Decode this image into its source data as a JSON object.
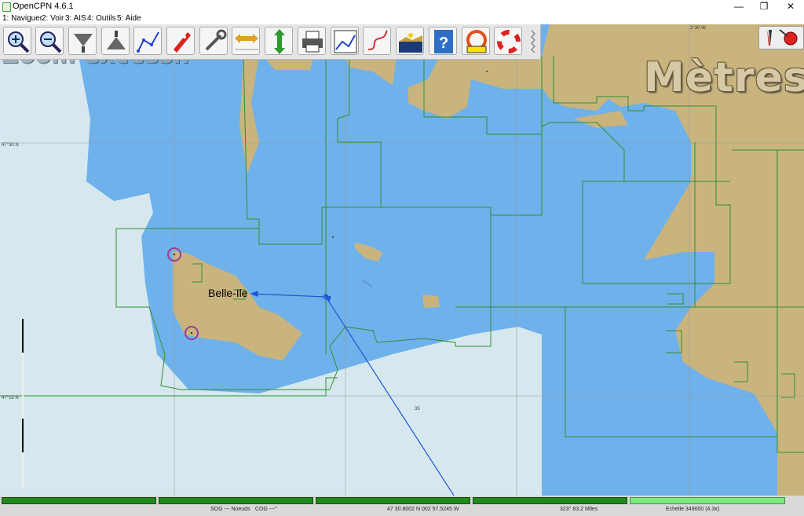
{
  "window": {
    "title": "OpenCPN 4.6.1",
    "minimize": "—",
    "restore": "❐",
    "close": "✕"
  },
  "menu": {
    "items": [
      "1: Naviguer",
      "2: Voir",
      "3: AIS",
      "4: Outils",
      "5: Aide"
    ]
  },
  "toolbar": {
    "buttons": [
      "zoom-in-icon",
      "zoom-out-icon",
      "scale-in-icon",
      "scale-out-icon",
      "route-icon",
      "ship-icon",
      "settings-icon",
      "auto-follow-icon",
      "tides-icon",
      "print-icon",
      "route-manager-icon",
      "track-icon",
      "chart-quilt-icon",
      "help-icon",
      "mob-icon",
      "lifebuoy-icon"
    ]
  },
  "chart": {
    "units_label": "Mètres",
    "overzoom_label": "Zoom excessif",
    "island_label": "Belle-Ile",
    "lat_labels": [
      "47°30 N",
      "47°15 N"
    ],
    "lon_label": "2°30 W",
    "depth_label": "35",
    "colors": {
      "deep_water": "#6fb1ea",
      "shallow_water": "#d6e8ee",
      "land": "#c9b47e",
      "coverage_outline": "#2f8f2f",
      "route": "#1f55d6",
      "waypoint_ring": "#9b3b9b"
    }
  },
  "status": {
    "sog": "SOG --- Noeuds",
    "cog": "COG ---°",
    "position": "47 30.8002 N   002 57.5245 W",
    "bearing": "323°  83.2 Miles",
    "scale": "Echelle 349000 (4.3x)"
  }
}
